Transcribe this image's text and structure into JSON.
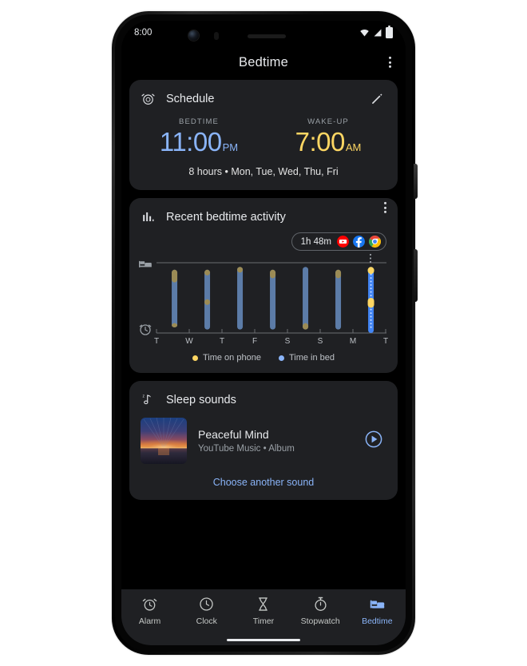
{
  "status_bar": {
    "time": "8:00",
    "icons": [
      "wifi-icon",
      "cell-signal-icon",
      "battery-icon"
    ]
  },
  "app_bar": {
    "title": "Bedtime",
    "overflow_icon": "kebab-menu-icon"
  },
  "schedule_card": {
    "icon": "alarm-clock-icon",
    "title": "Schedule",
    "edit_icon": "pencil-edit-icon",
    "bedtime_label": "BEDTIME",
    "bedtime_time": "11:00",
    "bedtime_meridiem": "PM",
    "bedtime_color": "#8ab4f8",
    "wakeup_label": "WAKE-UP",
    "wakeup_time": "7:00",
    "wakeup_meridiem": "AM",
    "wakeup_color": "#fdd663",
    "summary": "8 hours • Mon, Tue, Wed, Thu, Fri"
  },
  "activity_card": {
    "icon": "bar-chart-icon",
    "title": "Recent bedtime activity",
    "overflow_icon": "kebab-menu-icon",
    "usage_pill": {
      "duration": "1h 48m",
      "apps": [
        "youtube-icon",
        "facebook-icon",
        "chrome-icon"
      ]
    },
    "axis_top_icon": "bed-icon",
    "axis_bottom_icon": "alarm-clock-icon",
    "legend": [
      {
        "label": "Time on phone",
        "color": "#fdd663"
      },
      {
        "label": "Time in bed",
        "color": "#8ab4f8"
      }
    ]
  },
  "chart_data": {
    "type": "bar",
    "title": "Recent bedtime activity",
    "xlabel": "",
    "ylabel": "",
    "grid": false,
    "legend_position": "bottom",
    "categories": [
      "T",
      "W",
      "T",
      "F",
      "S",
      "S",
      "M",
      "T"
    ],
    "series": [
      {
        "name": "Time in bed",
        "color": "#5c7ca8",
        "highlight_color": "#4285f4"
      },
      {
        "name": "Time on phone",
        "color": "#9b8b55",
        "highlight_color": "#fdd663"
      }
    ],
    "bars": [
      {
        "day": "T",
        "in_bed_start": 10,
        "in_bed_end": 92,
        "phone_segments": [
          [
            10,
            28
          ],
          [
            86,
            92
          ]
        ],
        "highlight": false
      },
      {
        "day": "W",
        "in_bed_start": 10,
        "in_bed_end": 95,
        "phone_segments": [
          [
            10,
            18
          ],
          [
            52,
            60
          ]
        ],
        "highlight": false
      },
      {
        "day": "T",
        "in_bed_start": 6,
        "in_bed_end": 95,
        "phone_segments": [
          [
            6,
            14
          ]
        ],
        "highlight": false
      },
      {
        "day": "F",
        "in_bed_start": 10,
        "in_bed_end": 95,
        "phone_segments": [
          [
            10,
            22
          ]
        ],
        "highlight": false
      },
      {
        "day": "S",
        "in_bed_start": 6,
        "in_bed_end": 95,
        "phone_segments": [
          [
            86,
            95
          ]
        ],
        "highlight": false
      },
      {
        "day": "S",
        "in_bed_start": 10,
        "in_bed_end": 95,
        "phone_segments": [
          [
            10,
            22
          ]
        ],
        "highlight": false
      },
      {
        "day": "M",
        "in_bed_start": 6,
        "in_bed_end": 100,
        "phone_segments": [
          [
            6,
            16
          ],
          [
            50,
            64
          ]
        ],
        "highlight": true
      }
    ]
  },
  "sleep_sounds_card": {
    "icon": "sleep-music-note-icon",
    "title": "Sleep  sounds",
    "album_art": "sunset-over-water",
    "track_title": "Peaceful Mind",
    "track_subtitle": "YouTube Music • Album",
    "play_icon": "play-circle-icon",
    "choose_label": "Choose another sound"
  },
  "bottom_nav": {
    "items": [
      {
        "label": "Alarm",
        "icon": "alarm-clock-icon",
        "active": false
      },
      {
        "label": "Clock",
        "icon": "clock-icon",
        "active": false
      },
      {
        "label": "Timer",
        "icon": "hourglass-icon",
        "active": false
      },
      {
        "label": "Stopwatch",
        "icon": "stopwatch-icon",
        "active": false
      },
      {
        "label": "Bedtime",
        "icon": "bed-icon",
        "active": true
      }
    ]
  }
}
